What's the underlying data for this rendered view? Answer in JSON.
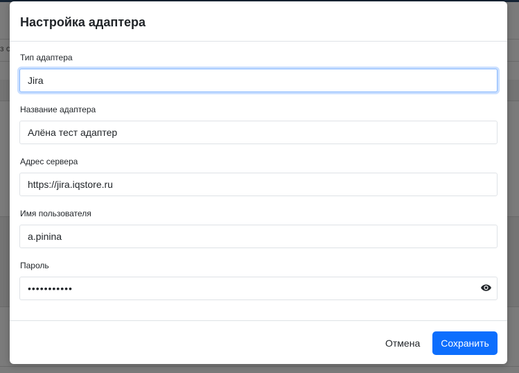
{
  "background": {
    "fragment_text": "з с"
  },
  "modal": {
    "title": "Настройка адаптера",
    "fields": [
      {
        "label": "Тип адаптера",
        "value": "Jira"
      },
      {
        "label": "Название адаптера",
        "value": "Алёна тест адаптер"
      },
      {
        "label": "Адрес сервера",
        "value": "https://jira.iqstore.ru"
      },
      {
        "label": "Имя пользователя",
        "value": "a.pinina"
      },
      {
        "label": "Пароль",
        "value": "•••••••••••"
      }
    ],
    "password_toggle_icon": "eye-icon",
    "footer": {
      "cancel_label": "Отмена",
      "save_label": "Сохранить"
    }
  },
  "colors": {
    "primary": "#0d6efd",
    "focus_border": "#86b7fe",
    "text": "#212529",
    "border": "#dee2e6",
    "topbar": "#152434"
  }
}
